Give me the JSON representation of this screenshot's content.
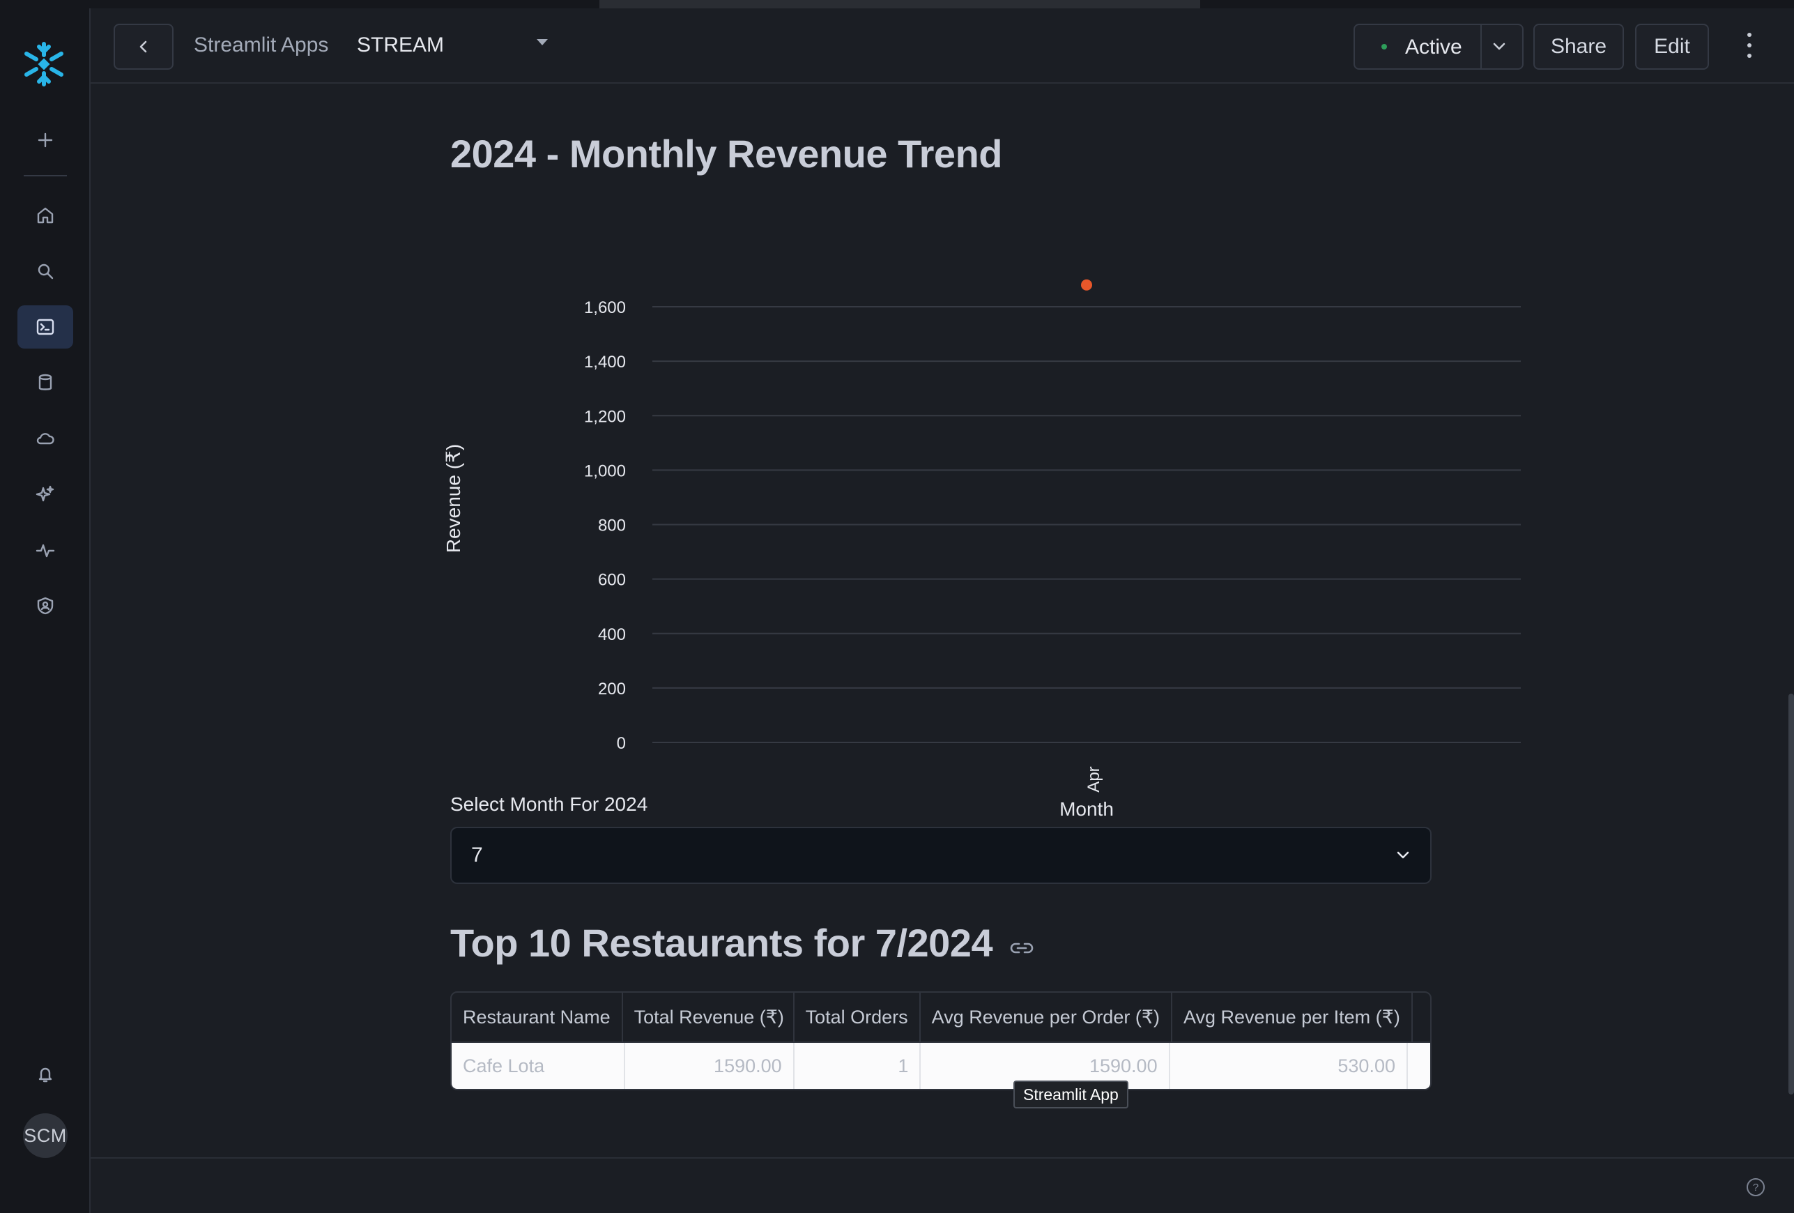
{
  "header": {
    "breadcrumb_parent": "Streamlit Apps",
    "app_name": "STREAM",
    "status_label": "Active",
    "share_label": "Share",
    "edit_label": "Edit"
  },
  "sidebar": {
    "avatar_initials": "SCM",
    "items": [
      {
        "icon": "plus-icon",
        "name": "create"
      },
      {
        "icon": "home-icon",
        "name": "home"
      },
      {
        "icon": "search-icon",
        "name": "search"
      },
      {
        "icon": "terminal-icon",
        "name": "projects"
      },
      {
        "icon": "database-icon",
        "name": "data"
      },
      {
        "icon": "cloud-icon",
        "name": "cloud"
      },
      {
        "icon": "sparkle-icon",
        "name": "ai-ml"
      },
      {
        "icon": "activity-icon",
        "name": "monitoring"
      },
      {
        "icon": "shield-icon",
        "name": "admin"
      },
      {
        "icon": "bell-icon",
        "name": "notifications"
      }
    ],
    "active_item": "projects"
  },
  "page": {
    "chart_title": "2024 - Monthly Revenue Trend",
    "select_label": "Select Month For 2024",
    "select_value": "7",
    "table_title": "Top 10 Restaurants for 7/2024",
    "tooltip": "Streamlit App"
  },
  "table": {
    "columns": [
      "Restaurant Name",
      "Total Revenue (₹)",
      "Total Orders",
      "Avg Revenue per Order (₹)",
      "Avg Revenue per Item (₹)"
    ],
    "rows": [
      [
        "Cafe Lota",
        "1590.00",
        "1",
        "1590.00",
        "530.00"
      ]
    ]
  },
  "chart_data": {
    "type": "scatter",
    "title": "2024 - Monthly Revenue Trend",
    "xlabel": "Month",
    "ylabel": "Revenue (₹)",
    "categories": [
      "Apr"
    ],
    "series": [
      {
        "values": [
          1680
        ]
      }
    ],
    "ylim": [
      0,
      1600
    ],
    "yticks": [
      0,
      200,
      400,
      600,
      800,
      1000,
      1200,
      1400,
      1600
    ],
    "ytick_labels": [
      "0",
      "200",
      "400",
      "600",
      "800",
      "1,000",
      "1,200",
      "1,400",
      "1,600"
    ],
    "grid": true,
    "point_color": "#e8572a"
  },
  "colors": {
    "accent": "#29b5e8",
    "status_dot": "#2e9e5a"
  }
}
